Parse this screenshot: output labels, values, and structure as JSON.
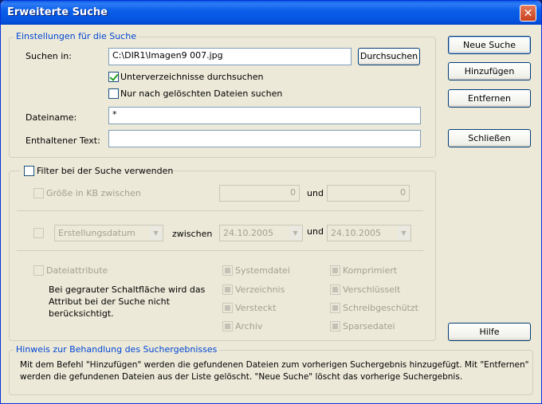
{
  "window": {
    "title": "Erweiterte Suche",
    "close_glyph": "✕"
  },
  "settings": {
    "legend": "Einstellungen für die Suche",
    "search_in_label": "Suchen in:",
    "search_in_value": "C:\\DIR1\\Imagen9 007.jpg",
    "browse_button": "Durchsuchen",
    "subdirs_label": "Unterverzeichnisse durchsuchen",
    "subdirs_checked": true,
    "deleted_label": "Nur nach gelöschten Dateien suchen",
    "deleted_checked": false,
    "filename_label": "Dateiname:",
    "filename_value": "*",
    "content_label": "Enthaltener Text:",
    "content_value": ""
  },
  "filter": {
    "legend": "Filter bei der Suche verwenden",
    "size_label": "Größe in KB zwischen",
    "size_from": "0",
    "size_and": "und",
    "size_to": "0",
    "date_type": "Erstellungsdatum",
    "date_between": "zwischen",
    "date_from": "24.10.2005",
    "date_and": "und",
    "date_to": "24.10.2005",
    "attr_label": "Dateiattribute",
    "attr_hint": [
      "Bei gegrauter Schaltfläche wird das",
      "Attribut bei der Suche nicht",
      "berücksichtigt."
    ],
    "attributes_left": [
      "Systemdatei",
      "Verzeichnis",
      "Versteckt",
      "Archiv"
    ],
    "attributes_right": [
      "Komprimiert",
      "Verschlüsselt",
      "Schreibgeschützt",
      "Sparsedatei"
    ]
  },
  "buttons": {
    "new_search": "Neue Suche",
    "add": "Hinzufügen",
    "remove": "Entfernen",
    "close": "Schließen",
    "help": "Hilfe"
  },
  "hint": {
    "legend": "Hinweis zur Behandlung des Suchergebnisses",
    "line1": "Mit dem Befehl \"Hinzufügen\" werden die gefundenen Dateien zum vorherigen Suchergebnis hinzugefügt. Mit \"Entfernen\"",
    "line2": "werden die gefundenen Dateien aus der Liste gelöscht. \"Neue Suche\" löscht das vorherige Suchergebnis."
  },
  "colors": {
    "titlebar": "#0a5fe9",
    "legend_text": "#0046d5",
    "dialog_bg": "#ece9d8"
  }
}
